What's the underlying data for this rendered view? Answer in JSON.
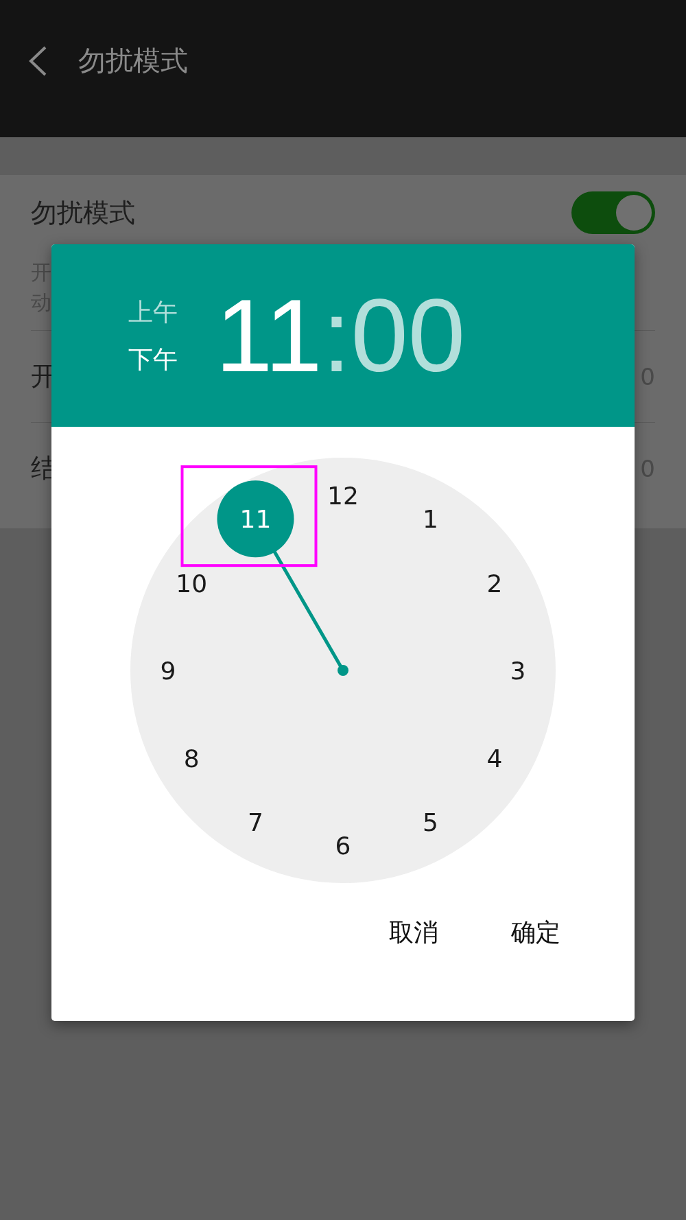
{
  "app_bar": {
    "title": "勿扰模式"
  },
  "settings": {
    "toggle_row": {
      "label": "勿扰模式",
      "on": true
    },
    "description_lines": [
      "开",
      "动"
    ],
    "rows": [
      {
        "label": "开",
        "value": "0"
      },
      {
        "label": "结",
        "value": "0"
      }
    ]
  },
  "dialog": {
    "period_options": [
      {
        "label": "上午",
        "selected": false
      },
      {
        "label": "下午",
        "selected": true
      }
    ],
    "time_parts": [
      {
        "text": "11",
        "selected": true
      },
      {
        "text": ":",
        "selected": false
      },
      {
        "text": "00",
        "selected": false
      }
    ],
    "dial_numbers": [
      {
        "label": "12",
        "selected": false
      },
      {
        "label": "1",
        "selected": false
      },
      {
        "label": "2",
        "selected": false
      },
      {
        "label": "3",
        "selected": false
      },
      {
        "label": "4",
        "selected": false
      },
      {
        "label": "5",
        "selected": false
      },
      {
        "label": "6",
        "selected": false
      },
      {
        "label": "7",
        "selected": false
      },
      {
        "label": "8",
        "selected": false
      },
      {
        "label": "9",
        "selected": false
      },
      {
        "label": "10",
        "selected": false
      },
      {
        "label": "11",
        "selected": true
      }
    ],
    "highlight_box": true,
    "buttons": [
      "取消",
      "确定"
    ]
  }
}
